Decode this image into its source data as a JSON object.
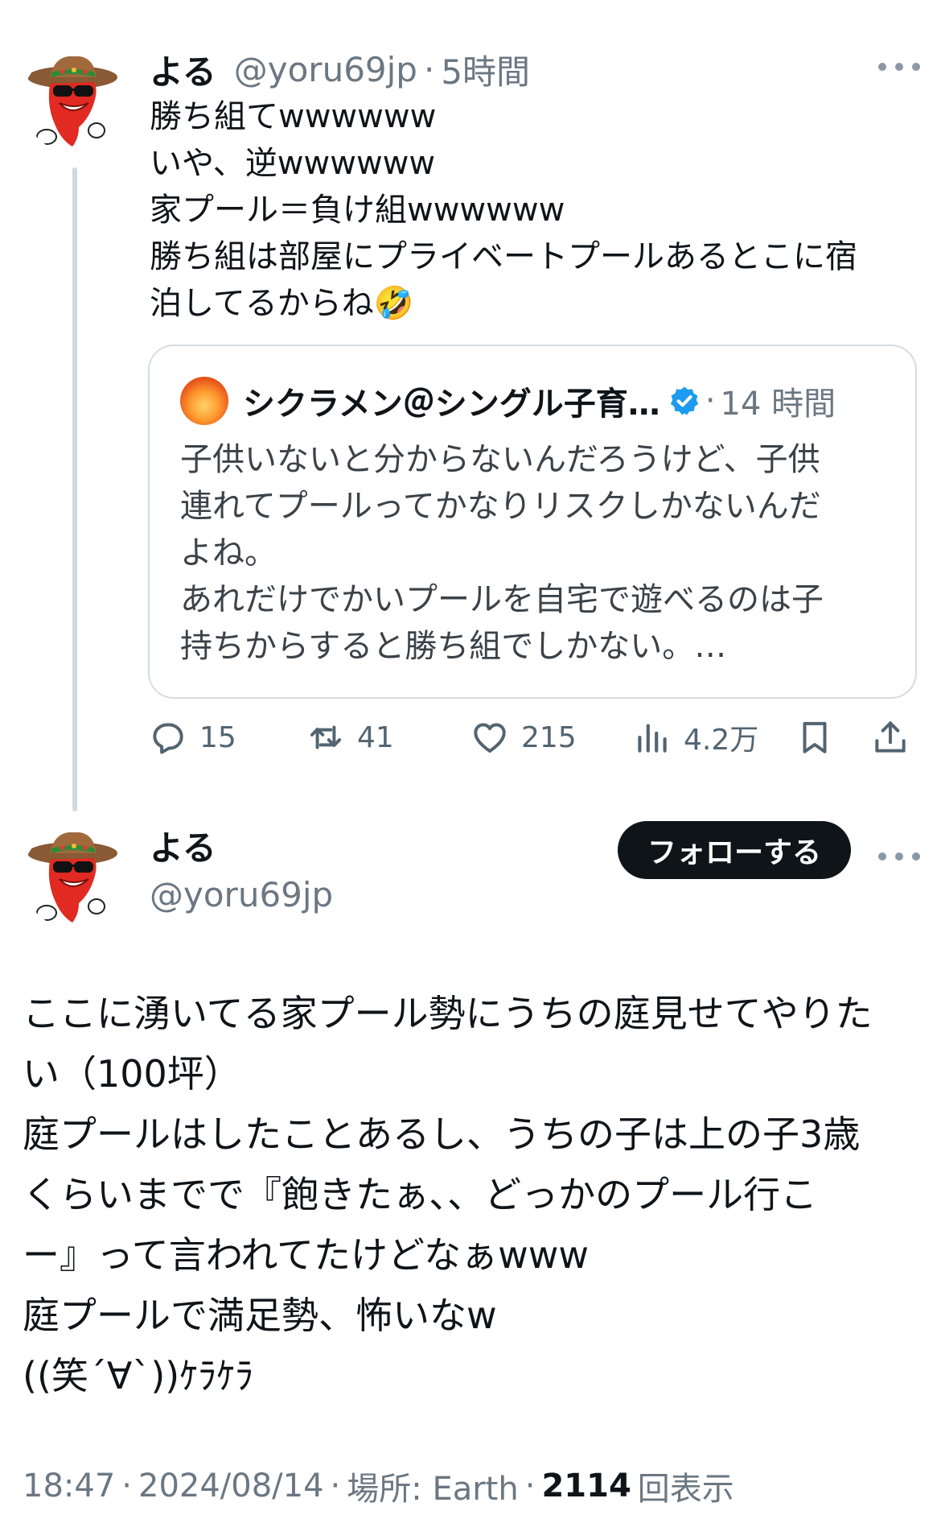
{
  "reply_tweet": {
    "display_name": "よる",
    "handle": "@yoru69jp",
    "separator": "·",
    "time": "5時間",
    "lines": [
      "勝ち組てwwwwww",
      "いや、逆wwwwww",
      "家プール＝負け組wwwwww",
      "勝ち組は部屋にプライベートプールあるとこに宿",
      "泊してるからね🤣"
    ],
    "quoted": {
      "display_name": "シクラメン＠シングル子育…",
      "separator": "·",
      "time": "14 時間",
      "lines": [
        "子供いないと分からないんだろうけど、子供",
        "連れてプールってかなりリスクしかないんだ",
        "よね。",
        "あれだけでかいプールを自宅で遊べるのは子",
        "持ちからすると勝ち組でしかない。…"
      ]
    },
    "actions": {
      "replies": "15",
      "retweets": "41",
      "likes": "215",
      "views": "4.2万"
    }
  },
  "main_tweet": {
    "display_name": "よる",
    "handle": "@yoru69jp",
    "follow_label": "フォローする",
    "lines": [
      "ここに湧いてる家プール勢にうちの庭見せてやりた",
      "い（100坪）",
      "庭プールはしたことあるし、うちの子は上の子3歳",
      "くらいまでで『飽きたぁ、、どっかのプール行こ",
      "ー』って言われてたけどなぁwww",
      "庭プールで満足勢、怖いなw",
      "((笑´∀`))ｹﾗｹﾗ"
    ],
    "meta": {
      "time": "18:47",
      "date": "2024/08/14",
      "location": "場所: Earth",
      "view_count": "2114",
      "view_label": "回表示",
      "separator": "·"
    }
  },
  "icons": {
    "reply": "reply-icon",
    "retweet": "retweet-icon",
    "like": "heart-icon",
    "views": "views-chart-icon",
    "bookmark": "bookmark-icon",
    "share": "share-icon",
    "more": "more-dots-icon",
    "verified": "verified-badge-icon"
  },
  "colors": {
    "text": "#0f1419",
    "muted": "#6b7782",
    "border": "#d6dde2",
    "verified": "#1d9bf0",
    "follow_bg": "#0f1419"
  }
}
